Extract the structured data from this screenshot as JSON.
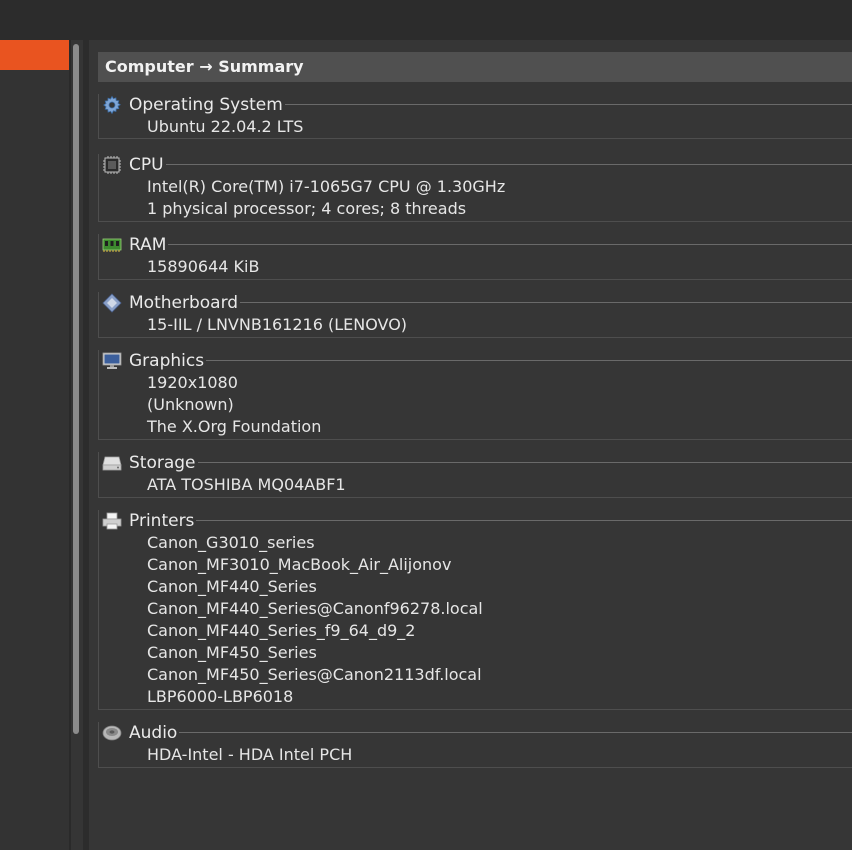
{
  "header": {
    "title": "Computer → Summary"
  },
  "sections": [
    {
      "title": "Operating System",
      "icon": "gear-icon",
      "items": [
        "Ubuntu 22.04.2 LTS"
      ]
    },
    {
      "title": "CPU",
      "icon": "cpu-chip-icon",
      "items": [
        "Intel(R) Core(TM) i7-1065G7 CPU @ 1.30GHz",
        "1 physical processor; 4 cores; 8 threads"
      ]
    },
    {
      "title": "RAM",
      "icon": "memory-module-icon",
      "items": [
        "15890644 KiB"
      ]
    },
    {
      "title": "Motherboard",
      "icon": "motherboard-icon",
      "items": [
        "15-IIL / LNVNB161216 (LENOVO)"
      ]
    },
    {
      "title": "Graphics",
      "icon": "monitor-icon",
      "items": [
        "1920x1080",
        "(Unknown)",
        "The X.Org Foundation"
      ]
    },
    {
      "title": "Storage",
      "icon": "hard-drive-icon",
      "items": [
        "ATA TOSHIBA MQ04ABF1"
      ]
    },
    {
      "title": "Printers",
      "icon": "printer-icon",
      "items": [
        "Canon_G3010_series",
        "Canon_MF3010_MacBook_Air_Alijonov",
        "Canon_MF440_Series",
        "Canon_MF440_Series@Canonf96278.local",
        "Canon_MF440_Series_f9_64_d9_2",
        "Canon_MF450_Series",
        "Canon_MF450_Series@Canon2113df.local",
        "LBP6000-LBP6018"
      ]
    },
    {
      "title": "Audio",
      "icon": "speaker-icon",
      "items": [
        "HDA-Intel - HDA Intel PCH"
      ]
    }
  ],
  "colors": {
    "accent": "#e95420",
    "background": "#363636",
    "header_bg": "#505050"
  }
}
